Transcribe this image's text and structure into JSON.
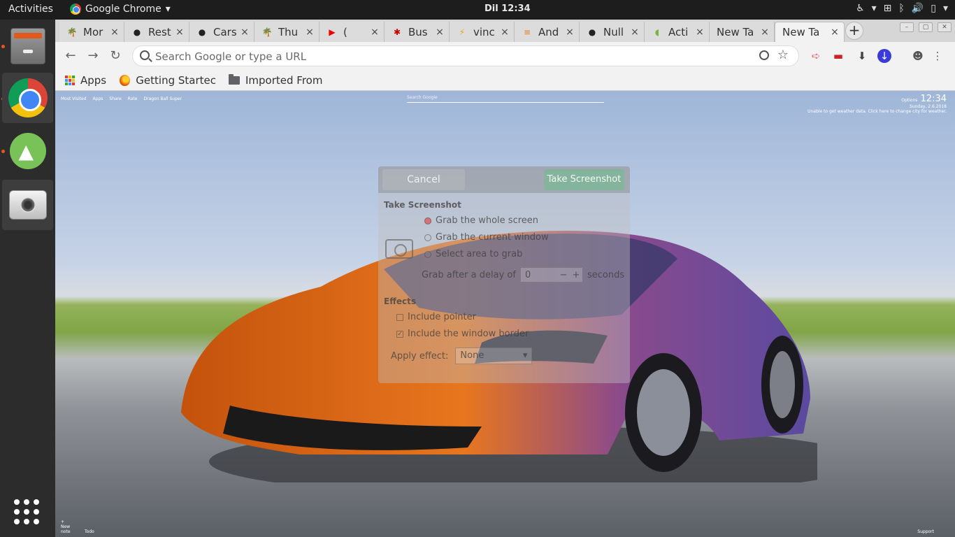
{
  "topbar": {
    "activities": "Activities",
    "app_name": "Google Chrome",
    "clock": "Dil 12:34"
  },
  "tabs": [
    {
      "label": "Mor",
      "icon": "tree-icon",
      "active": false
    },
    {
      "label": "Rest",
      "icon": "github-icon",
      "active": false
    },
    {
      "label": "Cars",
      "icon": "github-icon",
      "active": false
    },
    {
      "label": "Thu",
      "icon": "tree-icon",
      "active": false
    },
    {
      "label": "(",
      "icon": "youtube-icon",
      "active": false
    },
    {
      "label": "Bus",
      "icon": "yelp-icon",
      "active": false
    },
    {
      "label": "vinc",
      "icon": "bolt-icon",
      "active": false
    },
    {
      "label": "And",
      "icon": "stackoverflow-icon",
      "active": false
    },
    {
      "label": "Null",
      "icon": "github-icon",
      "active": false
    },
    {
      "label": "Acti",
      "icon": "android-icon",
      "active": false
    },
    {
      "label": "New Ta",
      "icon": "",
      "active": false
    },
    {
      "label": "New Ta",
      "icon": "",
      "active": true
    }
  ],
  "omnibox": {
    "placeholder": "Search Google or type a URL"
  },
  "bookmarks": {
    "apps": "Apps",
    "getting_started": "Getting Startec",
    "imported": "Imported From"
  },
  "newtab": {
    "links": [
      "Most Visited",
      "Apps",
      "Share",
      "Rate",
      "Dragon Ball Super"
    ],
    "search_placeholder": "Search Google",
    "options": "Options",
    "time": "12:34",
    "date": "Sunday, 2.6.2018",
    "weather": "Unable to get weather data. Click here to change city for weather.",
    "new_note": "+ New note",
    "todo": "Todo",
    "support": "Support"
  },
  "dialog": {
    "cancel": "Cancel",
    "take": "Take Screenshot",
    "section_take": "Take Screenshot",
    "opt_whole": "Grab the whole screen",
    "opt_window": "Grab the current window",
    "opt_area": "Select area to grab",
    "delay_label": "Grab after a delay of",
    "delay_value": "0",
    "seconds": "seconds",
    "section_effects": "Effects",
    "include_pointer": "Include pointer",
    "include_border": "Include the window border",
    "apply_effect": "Apply effect:",
    "effect_value": "None"
  },
  "colors": {
    "accent_ubuntu": "#e95420",
    "car_orange": "#e06a18",
    "dialog_take": "#6ebe8c"
  }
}
